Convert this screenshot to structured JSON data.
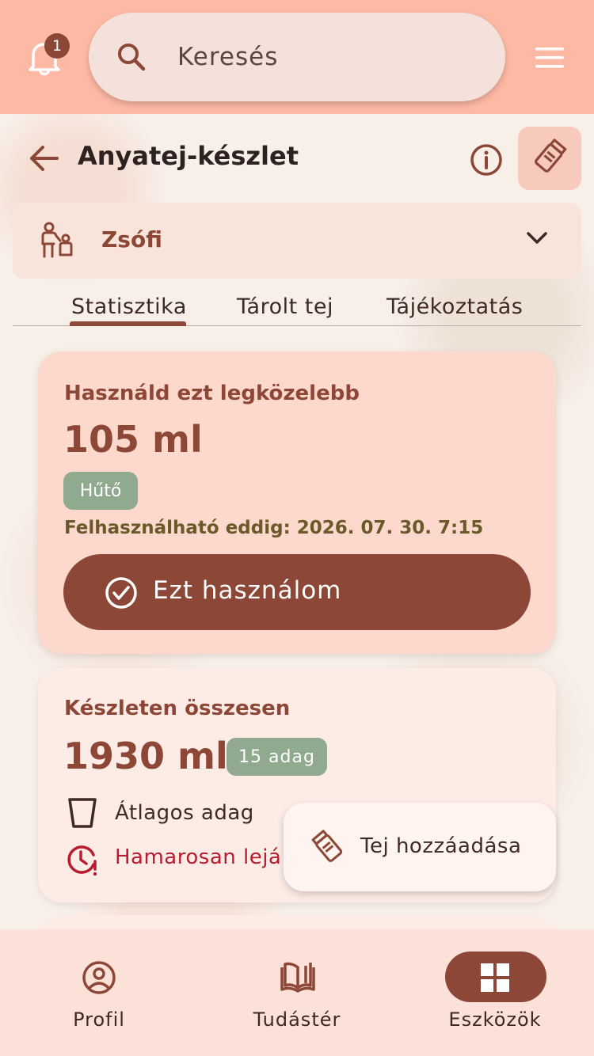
{
  "topbar": {
    "notification_count": "1",
    "search_placeholder": "Keresés"
  },
  "header": {
    "title": "Anyatej-készlet"
  },
  "child_selector": {
    "name": "Zsófi"
  },
  "tabs": [
    {
      "label": "Statisztika",
      "active": true
    },
    {
      "label": "Tárolt tej",
      "active": false
    },
    {
      "label": "Tájékoztatás",
      "active": false
    }
  ],
  "next_use_card": {
    "label": "Használd ezt legközelebb",
    "amount": "105 ml",
    "storage_chip": "Hűtő",
    "expiry": "Felhasználható eddig: 2026. 07. 30. 7:15",
    "use_button_label": "Ezt használom"
  },
  "stock_card": {
    "label": "Készleten összesen",
    "amount": "1930 ml",
    "portions_chip": "15 adag",
    "average_label": "Átlagos adag",
    "expiring_soon_label": "Hamarosan lejá"
  },
  "fab": {
    "label": "Tej hozzáadása"
  },
  "bottom_nav": [
    {
      "label": "Profil",
      "icon": "profile-icon",
      "active": false
    },
    {
      "label": "Tudástér",
      "icon": "book-icon",
      "active": false
    },
    {
      "label": "Eszközök",
      "icon": "grid-icon",
      "active": true
    }
  ],
  "colors": {
    "primary": "#8d4737",
    "topbar": "#fdb9a4",
    "chip_green": "#90aa90",
    "warning_red": "#b81c2e"
  }
}
